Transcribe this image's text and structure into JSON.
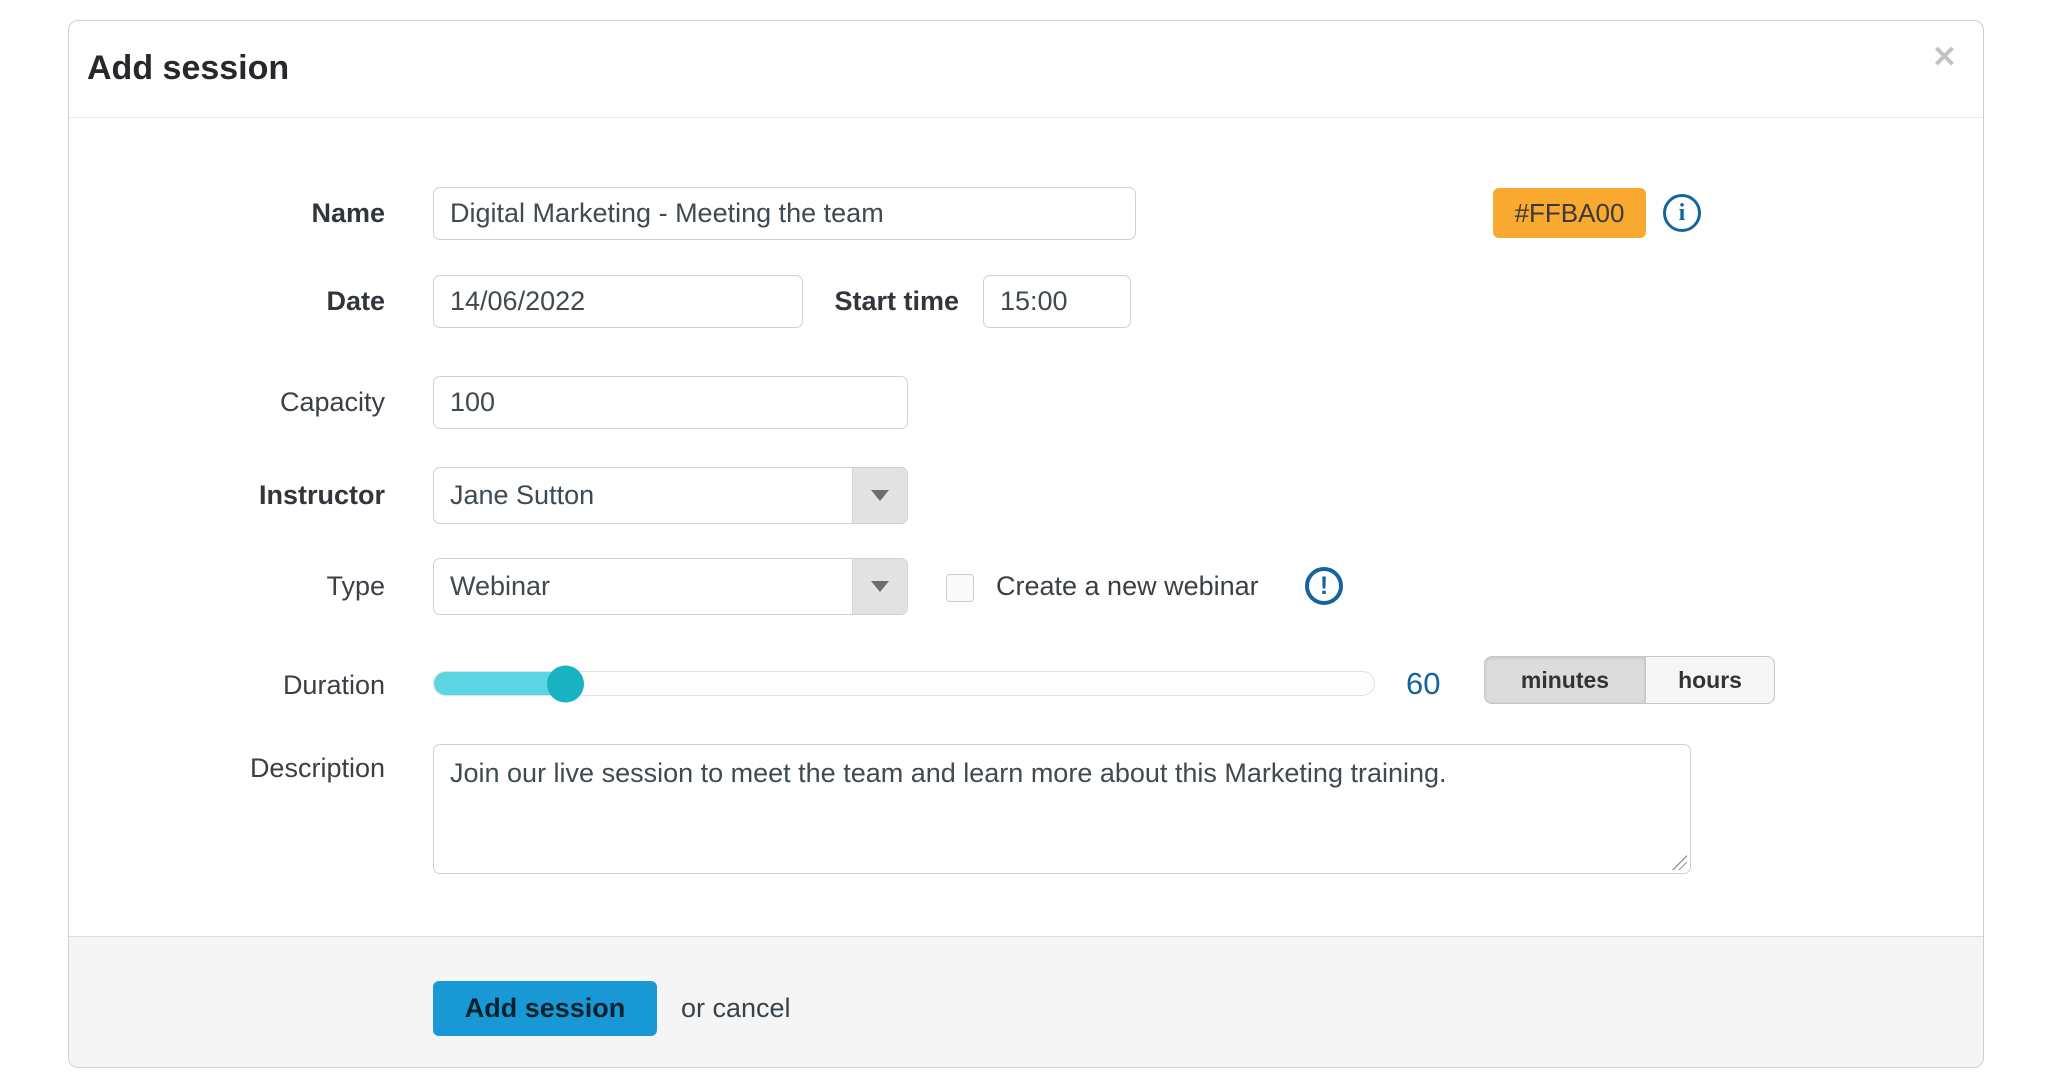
{
  "colors": {
    "badge_background": "#F9A930",
    "accent_blue": "#15649E",
    "button_blue": "#1899D6",
    "slider_fill": "#5CD6E2",
    "slider_handle": "#18B2C3"
  },
  "modal": {
    "title": "Add session",
    "close_icon": "✕"
  },
  "form": {
    "name": {
      "label": "Name",
      "value": "Digital Marketing - Meeting the team"
    },
    "color_badge": {
      "value": "#FFBA00"
    },
    "date": {
      "label": "Date",
      "value": "14/06/2022"
    },
    "start_time": {
      "label": "Start time",
      "value": "15:00"
    },
    "capacity": {
      "label": "Capacity",
      "value": "100"
    },
    "instructor": {
      "label": "Instructor",
      "value": "Jane Sutton"
    },
    "type": {
      "label": "Type",
      "value": "Webinar"
    },
    "create_webinar": {
      "label": "Create a new webinar",
      "checked": false
    },
    "duration": {
      "label": "Duration",
      "value": "60",
      "slider_percent": 14,
      "units": [
        {
          "label": "minutes",
          "selected": true
        },
        {
          "label": "hours",
          "selected": false
        }
      ]
    },
    "description": {
      "label": "Description",
      "value": "Join our live session to meet the team and learn more about this Marketing training."
    }
  },
  "icons": {
    "info": "i",
    "alert": "!"
  },
  "footer": {
    "submit_label": "Add session",
    "cancel_text": "or cancel"
  }
}
